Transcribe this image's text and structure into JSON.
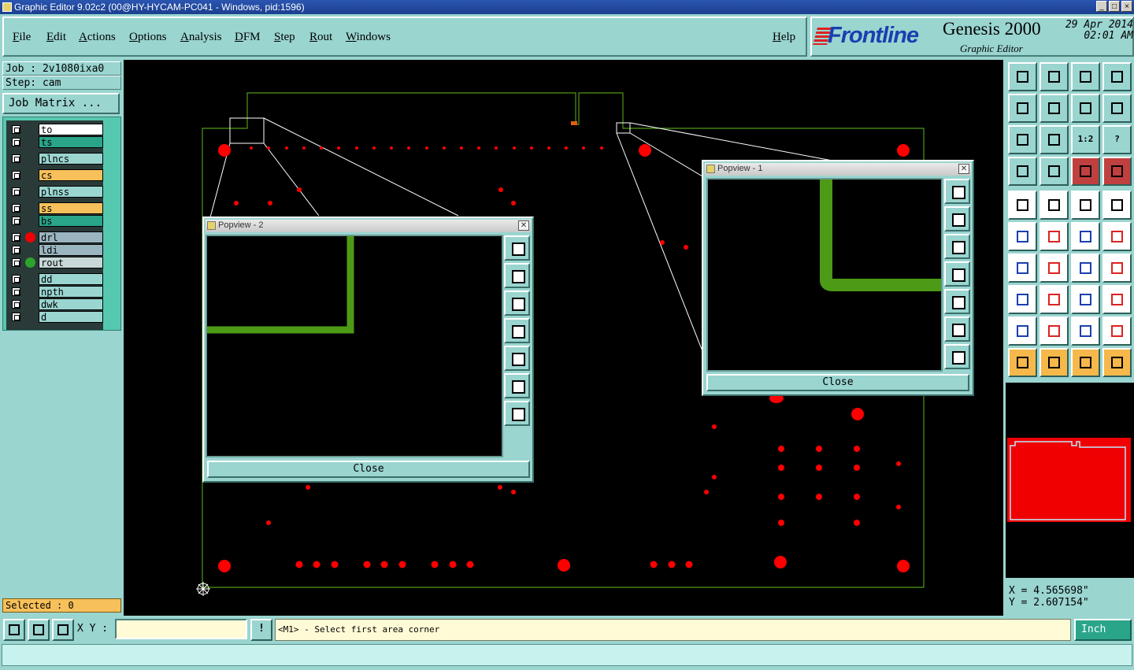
{
  "window": {
    "title": "Graphic Editor 9.02c2 (00@HY-HYCAM-PC041 - Windows, pid:1596)"
  },
  "menu": {
    "items": [
      "File",
      "Edit",
      "Actions",
      "Options",
      "Analysis",
      "DFM",
      "Step",
      "Rout",
      "Windows"
    ],
    "help": "Help"
  },
  "brand": {
    "logo": "Frontline",
    "product": "Genesis 2000",
    "subtitle": "Graphic Editor",
    "date": "29 Apr 2014",
    "time": "02:01 AM"
  },
  "job": {
    "job_line": "Job : 2v1080ixa0",
    "step_line": "Step: cam",
    "matrix_button": "Job Matrix ..."
  },
  "layers": [
    {
      "name": "to",
      "color": "#ffffff",
      "marker": ""
    },
    {
      "name": "ts",
      "color": "#2aa58a",
      "marker": ""
    },
    {
      "name": "plncs",
      "color": "#9ad5d0",
      "marker": ""
    },
    {
      "name": "cs",
      "color": "#f7c05a",
      "marker": ""
    },
    {
      "name": "plnss",
      "color": "#9ad5d0",
      "marker": ""
    },
    {
      "name": "ss",
      "color": "#f7c05a",
      "marker": ""
    },
    {
      "name": "bs",
      "color": "#2aa58a",
      "marker": ""
    },
    {
      "name": "drl",
      "color": "#9ab5c0",
      "marker": "#f00000"
    },
    {
      "name": "ldi",
      "color": "#9ab5c0",
      "marker": ""
    },
    {
      "name": "rout",
      "color": "#c8d8d8",
      "marker": "#2aa52a"
    },
    {
      "name": "dd",
      "color": "#9ad5d0",
      "marker": ""
    },
    {
      "name": "npth",
      "color": "#9ad5d0",
      "marker": ""
    },
    {
      "name": "dwk",
      "color": "#9ad5d0",
      "marker": ""
    },
    {
      "name": "d",
      "color": "#9ad5d0",
      "marker": ""
    }
  ],
  "selected": "Selected : 0",
  "popview2": {
    "title": "Popview - 2",
    "close": "Close"
  },
  "popview1": {
    "title": "Popview - 1",
    "close": "Close"
  },
  "toolbox": {
    "zoom_ratio_label": "1:2",
    "help_label": "?"
  },
  "coords": {
    "x": "X = 4.565698\"",
    "y": "Y = 2.607154\""
  },
  "status": {
    "xy_label": "X Y :",
    "xy_value": "",
    "alert": "!",
    "prompt": "<M1> - Select first area corner",
    "units": "Inch"
  }
}
